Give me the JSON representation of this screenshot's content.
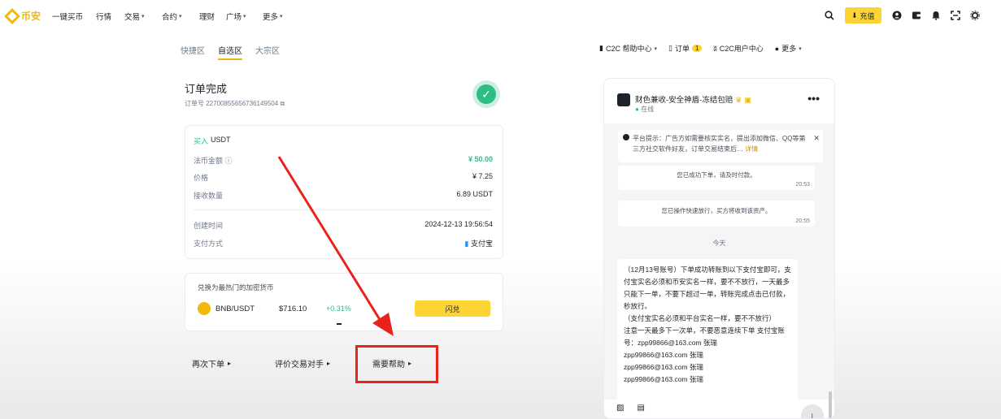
{
  "topnav": {
    "logo": "币安",
    "items": [
      {
        "label": "一键买币",
        "caret": false
      },
      {
        "label": "行情",
        "caret": false
      },
      {
        "label": "交易",
        "caret": true
      },
      {
        "label": "合约",
        "caret": true
      },
      {
        "label": "理财",
        "caret": false
      },
      {
        "label": "广场",
        "caret": true
      },
      {
        "label": "更多",
        "caret": true
      }
    ],
    "deposit": "充值"
  },
  "subnav": {
    "tabs": [
      "快捷区",
      "自选区",
      "大宗区"
    ],
    "active": "自选区",
    "right": {
      "help": "C2C 帮助中心",
      "orders": "订单",
      "orders_badge": "1",
      "user_center": "C2C用户中心",
      "more": "更多"
    }
  },
  "order": {
    "title": "订单完成",
    "order_no": "订单号 22700855656736149504"
  },
  "details": {
    "buy_label": "买入",
    "asset": "USDT",
    "rows": [
      {
        "k": "法币金额",
        "v": "¥ 50.00"
      },
      {
        "k": "价格",
        "v": "¥ 7.25"
      },
      {
        "k": "接收数量",
        "v": "6.89 USDT"
      }
    ],
    "created_label": "创建时间",
    "created_value": "2024-12-13 19:56:54",
    "payment_label": "支付方式",
    "payment_value": "支付宝"
  },
  "convert": {
    "title": "兑换为最热门的加密货币",
    "pair": "BNB/USDT",
    "price": "$716.10",
    "change": "+0.31%",
    "button": "闪兑"
  },
  "actions": {
    "reorder": "再次下单",
    "rate": "评价交易对手",
    "help": "需要帮助"
  },
  "chat": {
    "name": "财色兼收-安全神盾-冻结包赔",
    "status": "在线",
    "notice": "平台提示：广告方如需要核实实名，提出添加微信、QQ等第三方社交软件好友，订单交易结束后…",
    "notice_link": "详情",
    "sys1": {
      "text": "您已成功下单，请及时付款。",
      "time": "20:53"
    },
    "sys2": {
      "text": "您已操作快速放行，买方将收到该资产。",
      "time": "20:55"
    },
    "today": "今天",
    "message": "（12月13号账号）下单成功转账到以下支付宝即可，支付宝实名必须和币安实名一样，要不不放行，一天最多只能下一单，不要下超过一单，转账完成点击已付款，秒放行。\n（支付宝实名必须和平台实名一样，要不不放行）\n注意一天最多下一次单，不要恶意连续下单 支付宝账号：zpp99866@163.com 张瑞\nzpp99866@163.com 张瑞\nzpp99866@163.com 张瑞\nzpp99866@163.com 张瑞"
  },
  "colors": {
    "brand": "#f0b90b",
    "button": "#fcd535",
    "green": "#2ebd85",
    "highlight": "#e8231c"
  }
}
